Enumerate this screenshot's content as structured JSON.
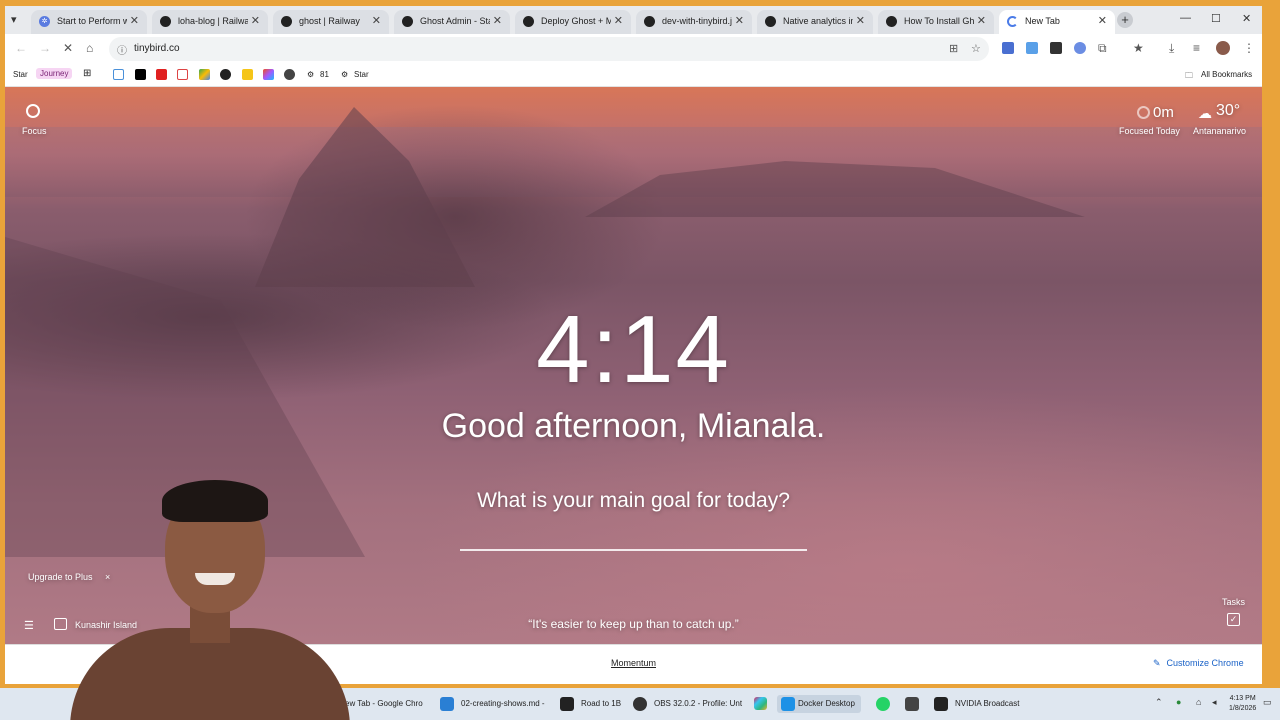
{
  "tabs": [
    {
      "title": "Start to Perform with",
      "icon": "gear-icon"
    },
    {
      "title": "loha-blog | Railway",
      "icon": "railway-icon"
    },
    {
      "title": "ghost | Railway",
      "icon": "railway-icon"
    },
    {
      "title": "Ghost Admin - Start",
      "icon": "ghost-icon"
    },
    {
      "title": "Deploy Ghost + MyS",
      "icon": "railway-icon"
    },
    {
      "title": "dev-with-tinybird.js",
      "icon": "github-icon"
    },
    {
      "title": "Native analytics in G",
      "icon": "ghost-icon"
    },
    {
      "title": "How To Install Ghost",
      "icon": "ghost-icon"
    },
    {
      "title": "New Tab",
      "icon": "loading-icon"
    }
  ],
  "toolbar": {
    "url": "tinybird.co"
  },
  "bookmarks": {
    "star1": "Star",
    "journey": "Journey",
    "count": "81",
    "star2": "Star",
    "all": "All Bookmarks"
  },
  "page": {
    "focus_label": "Focus",
    "focused_value": "0m",
    "focused_label": "Focused Today",
    "weather_value": "30°",
    "weather_location": "Antananarivo",
    "clock": "4:14",
    "greeting": "Good afternoon, Mianala.",
    "goal_prompt": "What is your main goal for today?",
    "upgrade": "Upgrade to Plus",
    "upgrade_close": "×",
    "photo_location": "Kunashir Island",
    "quote": "“It's easier to keep up than to catch up.”",
    "tasks_label": "Tasks"
  },
  "footer": {
    "momentum": "Momentum",
    "customize": "Customize Chrome"
  },
  "taskbar": {
    "items": [
      {
        "label": "ew Tab - Google Chro",
        "icon": "chrome-icon",
        "color": "#4a90d9"
      },
      {
        "label": "02-creating-shows.md -",
        "icon": "vscode-icon",
        "color": "#2a7fd4"
      },
      {
        "label": "Road to 1B",
        "icon": "notion-icon",
        "color": "#222222"
      },
      {
        "label": "OBS 32.0.2 - Profile: Unt",
        "icon": "obs-icon",
        "color": "#333333"
      },
      {
        "label": "Docker Desktop",
        "icon": "docker-icon",
        "color": "#1d91e6"
      },
      {
        "label": "NVIDIA Broadcast",
        "icon": "nvidia-icon",
        "color": "#222222"
      }
    ],
    "time": "4:13 PM",
    "date": "1/8/2026"
  },
  "colors": {
    "accent": "#1a62c7",
    "frame": "#e9a33a"
  }
}
